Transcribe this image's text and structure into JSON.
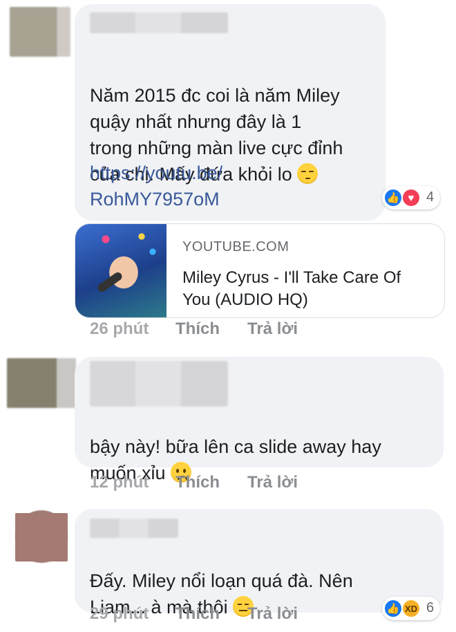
{
  "comments": [
    {
      "text": "Năm 2015 đc coi là năm Miley\nquậy nhất nhưng đây là 1\ntrong những màn live cực đỉnh\ncủa chị. Mấy đứa khỏi lo",
      "emoji": "relieved-face-emoji",
      "link": "https://youtu.be/\nRohMY7957oM",
      "reaction_count": "4",
      "reaction_icons": [
        "like-icon",
        "love-icon"
      ],
      "link_preview": {
        "source": "YOUTUBE.COM",
        "title": "Miley Cyrus - I'll Take Care Of You (AUDIO HQ)"
      },
      "time": "26 phút",
      "like_label": "Thích",
      "reply_label": "Trả lời"
    },
    {
      "text": "bậy này! bữa lên ca slide away hay\nmuốn xỉu",
      "emoji": "frowning-face-emoji",
      "time": "12 phút",
      "like_label": "Thích",
      "reply_label": "Trả lời"
    },
    {
      "text": "Đấy. Miley nổi loạn quá đà. Nên\nLiam... à mà thôi",
      "emoji": "expressionless-face-emoji",
      "reaction_count": "6",
      "reaction_icons": [
        "like-icon",
        "haha-icon"
      ],
      "time": "29 phút",
      "like_label": "Thích",
      "reply_label": "Trả lời"
    }
  ],
  "colors": {
    "bubble": "#f0f2f5",
    "link": "#385898",
    "like_blue": "#1877f2",
    "love_red": "#f33e58",
    "meta_gray": "#8a8d91"
  }
}
